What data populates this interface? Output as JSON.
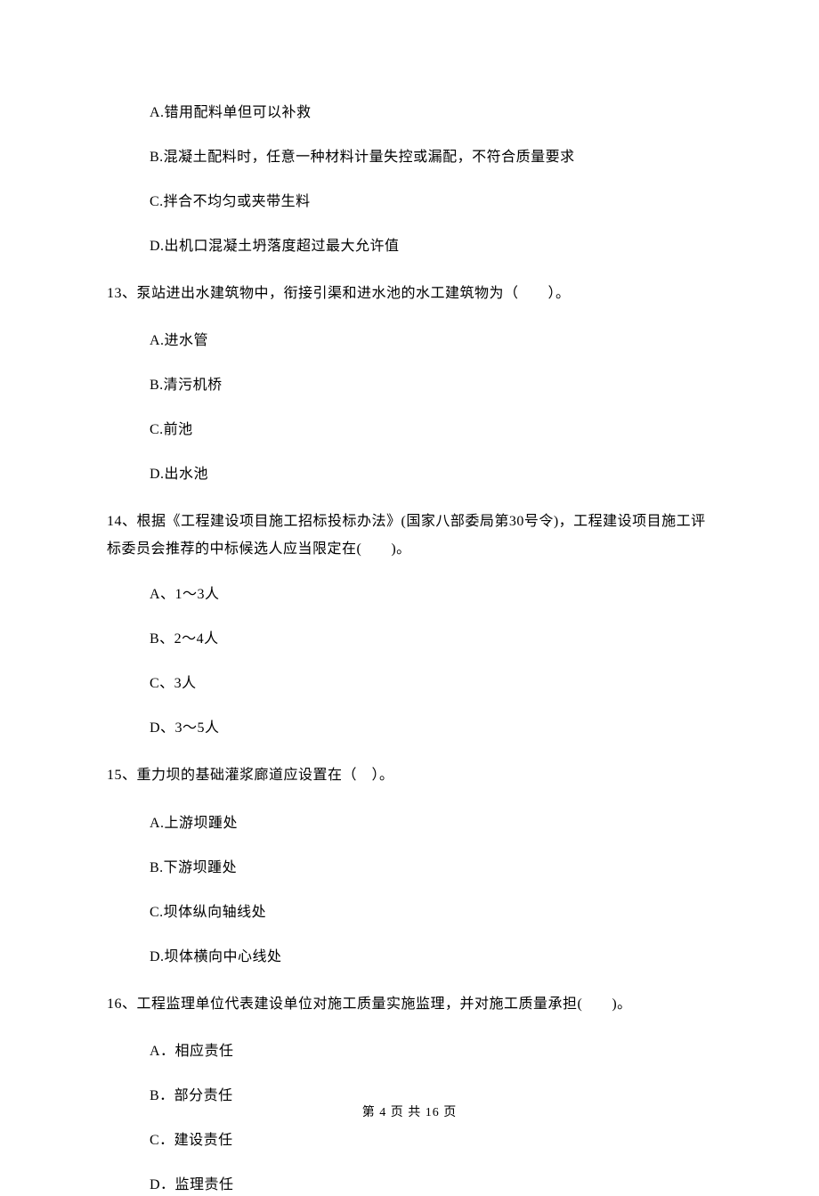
{
  "q12_options": {
    "a": "A.错用配料单但可以补救",
    "b": "B.混凝土配料时，任意一种材料计量失控或漏配，不符合质量要求",
    "c": "C.拌合不均匀或夹带生料",
    "d": "D.出机口混凝土坍落度超过最大允许值"
  },
  "q13": {
    "text": "13、泵站进出水建筑物中，衔接引渠和进水池的水工建筑物为（　　）。",
    "options": {
      "a": "A.进水管",
      "b": "B.清污机桥",
      "c": "C.前池",
      "d": "D.出水池"
    }
  },
  "q14": {
    "text": "14、根据《工程建设项目施工招标投标办法》(国家八部委局第30号令)，工程建设项目施工评标委员会推荐的中标候选人应当限定在(　　)。",
    "options": {
      "a": "A、1～3人",
      "b": "B、2～4人",
      "c": "C、3人",
      "d": "D、3～5人"
    }
  },
  "q15": {
    "text": "15、重力坝的基础灌浆廊道应设置在（　）。",
    "options": {
      "a": "A.上游坝踵处",
      "b": "B.下游坝踵处",
      "c": "C.坝体纵向轴线处",
      "d": "D.坝体横向中心线处"
    }
  },
  "q16": {
    "text": "16、工程监理单位代表建设单位对施工质量实施监理，并对施工质量承担(　　)。",
    "options": {
      "a": "A．相应责任",
      "b": "B．部分责任",
      "c": "C．建设责任",
      "d": "D．监理责任"
    }
  },
  "footer": "第 4 页 共 16 页"
}
